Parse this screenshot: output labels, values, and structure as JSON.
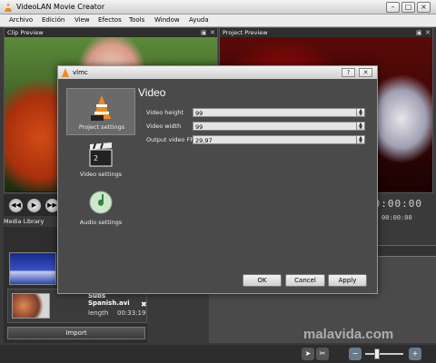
{
  "window": {
    "title": "VideoLAN Movie Creator"
  },
  "menu": [
    "Archivo",
    "Edición",
    "View",
    "Efectos",
    "Tools",
    "Window",
    "Ayuda"
  ],
  "panels": {
    "clip_preview": "Clip Preview",
    "project_preview": "Project Preview",
    "media_library": "Media Library"
  },
  "timecode": {
    "main": "00:00:00",
    "sub": "00:00:00"
  },
  "media": {
    "item": {
      "name": "Subs Spanish.avi",
      "length_label": "length",
      "length_value": "00:33:19"
    },
    "import_label": "Import"
  },
  "dialog": {
    "title": "vlmc",
    "heading": "Video",
    "sidebar": [
      {
        "label": "Project settings",
        "icon": "clapper-cone-icon",
        "active": true
      },
      {
        "label": "Video settings",
        "icon": "clapperboard-icon",
        "active": false
      },
      {
        "label": "Audio settings",
        "icon": "audio-disc-icon",
        "active": false
      }
    ],
    "fields": [
      {
        "label": "Video height",
        "value": "99"
      },
      {
        "label": "Video width",
        "value": "99"
      },
      {
        "label": "Output video FPS",
        "value": "29,97"
      }
    ],
    "buttons": {
      "ok": "OK",
      "cancel": "Cancel",
      "apply": "Apply"
    }
  },
  "watermark": "malavida.com"
}
